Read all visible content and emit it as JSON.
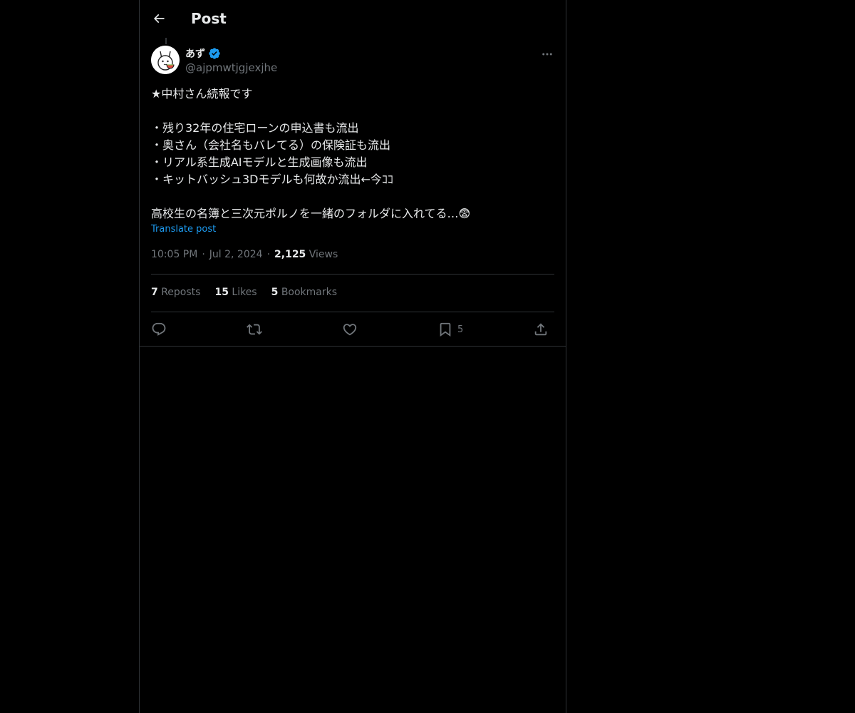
{
  "header": {
    "title": "Post"
  },
  "post": {
    "display_name": "あず",
    "handle": "@ajpmwtjgjexjhe",
    "text_lines": [
      "★中村さん続報です",
      "",
      "・残り32年の住宅ローンの申込書も流出",
      "・奥さん（会社名もバレてる）の保険証も流出",
      "・リアル系生成AIモデルと生成画像も流出",
      "・キットバッシュ3Dモデルも何故か流出←今ｺｺ",
      "",
      "高校生の名簿と三次元ポルノを一緒のフォルダに入れてる…😨"
    ],
    "translate_label": "Translate post",
    "time": "10:05 PM",
    "date": "Jul 2, 2024",
    "views_count": "2,125",
    "views_label": "Views",
    "separator": "·"
  },
  "stats": {
    "reposts_count": "7",
    "reposts_label": "Reposts",
    "likes_count": "15",
    "likes_label": "Likes",
    "bookmarks_count": "5",
    "bookmarks_label": "Bookmarks"
  },
  "actions": {
    "bookmark_count": "5"
  },
  "icons": {
    "back": "arrow-left-icon",
    "verified": "verified-badge-icon",
    "more": "more-horizontal-icon",
    "reply": "reply-icon",
    "repost": "repost-icon",
    "like": "heart-icon",
    "bookmark": "bookmark-icon",
    "share": "share-icon"
  },
  "colors": {
    "background": "#000000",
    "text": "#e7e9ea",
    "secondary": "#71767b",
    "accent": "#1d9bf0",
    "border": "#2f3336"
  }
}
